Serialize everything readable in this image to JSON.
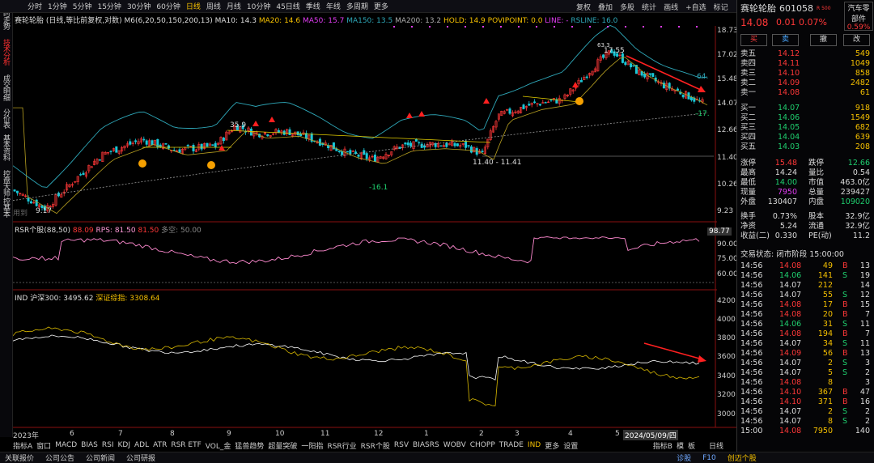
{
  "topbar": {
    "periods": [
      "分时",
      "1分钟",
      "5分钟",
      "15分钟",
      "30分钟",
      "60分钟",
      "日线",
      "周线",
      "月线",
      "10分钟",
      "45日线",
      "季线",
      "年线",
      "多周期",
      "更多"
    ],
    "active_period": "日线",
    "tools": [
      "复权",
      "叠加",
      "多股",
      "统计",
      "画线",
      "+自选",
      "标记"
    ]
  },
  "left_tabs": [
    "分时走势",
    "技术分析",
    "成交明细",
    "分价表",
    "基本资料",
    "控盘大师",
    "控基本"
  ],
  "legend_main": {
    "title": "赛轮轮胎 (日线,等比前复权,对数)",
    "ma_label": "M6(6,20,50,150,200,13)",
    "ma10": "MA10: 14.3",
    "ma20": "MA20: 14.6",
    "ma50": "MA50: 15.7",
    "ma150": "MA150: 13.5",
    "ma200": "MA200: 13.2",
    "hold": "HOLD: 14.9",
    "povi": "POVIPOINT: 0.0",
    "line": "LINE: -",
    "rsline": "RSLINE: 16.0"
  },
  "price_axis": [
    "18.73",
    "17.02",
    "15.48",
    "14.07",
    "12.66",
    "11.40",
    "10.26",
    "9.23"
  ],
  "annotations": {
    "high": "17.55",
    "high2": "63.3",
    "low": "-16.1",
    "lo9": "9.17",
    "mid": "35.9",
    "range": "11.40 - 11.41",
    "r64": "64.",
    "r17": "-17.",
    "used": "用到"
  },
  "rsr": {
    "legend": "RSR个股(88,50)",
    "v1": "88.09",
    "rps": "RPS: 81.50",
    "v2": "81.50",
    "flat": "多空: 50.00",
    "axis": [
      "98.77",
      "90.00",
      "75.00",
      "60.00"
    ]
  },
  "ind": {
    "legend": "IND",
    "hs300": "沪深300: 3495.62",
    "szzs": "深证综指: 3308.64",
    "axis": [
      "4200",
      "4000",
      "3800",
      "3600",
      "3400",
      "3200",
      "3000"
    ]
  },
  "x_axis": [
    "2023年",
    "6",
    "7",
    "8",
    "9",
    "10",
    "11",
    "12",
    "1",
    "2",
    "3",
    "4",
    "5",
    "2024/05/09/四"
  ],
  "bottom_tabs": [
    "指标A",
    "窗口",
    "MACD",
    "BIAS",
    "RSI",
    "KDJ",
    "ADL",
    "ATR",
    "RSR ETF",
    "VOL_金",
    "猛兽趋势",
    "超量突破",
    "一阳指",
    "RSR行业",
    "RSR个股",
    "RSV",
    "BIASRS",
    "WOBV",
    "CHOPP",
    "TRADE",
    "IND",
    "更多",
    "设置"
  ],
  "bottom_right": [
    "指标B",
    "模",
    "板",
    "日线"
  ],
  "status": [
    "关联报价",
    "公司公告",
    "公司新闻",
    "公司研报"
  ],
  "status_right": [
    "诊股",
    "F10",
    "创迈个股"
  ],
  "quote": {
    "name": "赛轮轮胎",
    "code": "601058",
    "tag": "R 500",
    "sector": "汽车零部件",
    "sector_pct": "0.59%",
    "price": "14.08",
    "chg": "0.01",
    "pct": "0.07%",
    "buttons": [
      "买",
      "卖",
      "撤",
      "改"
    ],
    "asks": [
      [
        "卖五",
        "14.12",
        "549"
      ],
      [
        "卖四",
        "14.11",
        "1049"
      ],
      [
        "卖三",
        "14.10",
        "858"
      ],
      [
        "卖二",
        "14.09",
        "2482"
      ],
      [
        "卖一",
        "14.08",
        "61"
      ]
    ],
    "bids": [
      [
        "买一",
        "14.07",
        "918"
      ],
      [
        "买二",
        "14.06",
        "1549"
      ],
      [
        "买三",
        "14.05",
        "682"
      ],
      [
        "买四",
        "14.04",
        "639"
      ],
      [
        "买五",
        "14.03",
        "208"
      ]
    ],
    "stats": [
      [
        "涨停",
        "15.48",
        "跌停",
        "12.66"
      ],
      [
        "最高",
        "14.24",
        "量比",
        "0.54"
      ],
      [
        "最低",
        "14.00",
        "市值",
        "463.0亿"
      ],
      [
        "现量",
        "7950",
        "总量",
        "239427"
      ],
      [
        "外盘",
        "130407",
        "内盘",
        "109020"
      ],
      [
        "换手",
        "0.73%",
        "股本",
        "32.9亿"
      ],
      [
        "净资",
        "5.24",
        "流通",
        "32.9亿"
      ],
      [
        "收益(二)",
        "0.330",
        "PE(动)",
        "11.2"
      ]
    ],
    "trade_status": "交易状态: 闭市阶段 15:00:00",
    "ticks": [
      [
        "14:56",
        "14.08",
        "49",
        "B",
        "13"
      ],
      [
        "14:56",
        "14.06",
        "141",
        "S",
        "19"
      ],
      [
        "14:56",
        "14.07",
        "212",
        "",
        "14"
      ],
      [
        "14:56",
        "14.07",
        "55",
        "S",
        "12"
      ],
      [
        "14:56",
        "14.08",
        "17",
        "B",
        "15"
      ],
      [
        "14:56",
        "14.08",
        "20",
        "B",
        "7"
      ],
      [
        "14:56",
        "14.06",
        "31",
        "S",
        "11"
      ],
      [
        "14:56",
        "14.08",
        "194",
        "B",
        "7"
      ],
      [
        "14:56",
        "14.07",
        "34",
        "S",
        "11"
      ],
      [
        "14:56",
        "14.09",
        "56",
        "B",
        "13"
      ],
      [
        "14:56",
        "14.07",
        "2",
        "S",
        "3"
      ],
      [
        "14:56",
        "14.07",
        "5",
        "S",
        "2"
      ],
      [
        "14:56",
        "14.08",
        "8",
        "",
        "3"
      ],
      [
        "14:56",
        "14.10",
        "367",
        "B",
        "47"
      ],
      [
        "14:56",
        "14.10",
        "371",
        "B",
        "16"
      ],
      [
        "14:56",
        "14.07",
        "2",
        "S",
        "2"
      ],
      [
        "14:56",
        "14.07",
        "8",
        "S",
        "2"
      ],
      [
        "15:00",
        "14.08",
        "7950",
        "",
        "140"
      ]
    ]
  }
}
